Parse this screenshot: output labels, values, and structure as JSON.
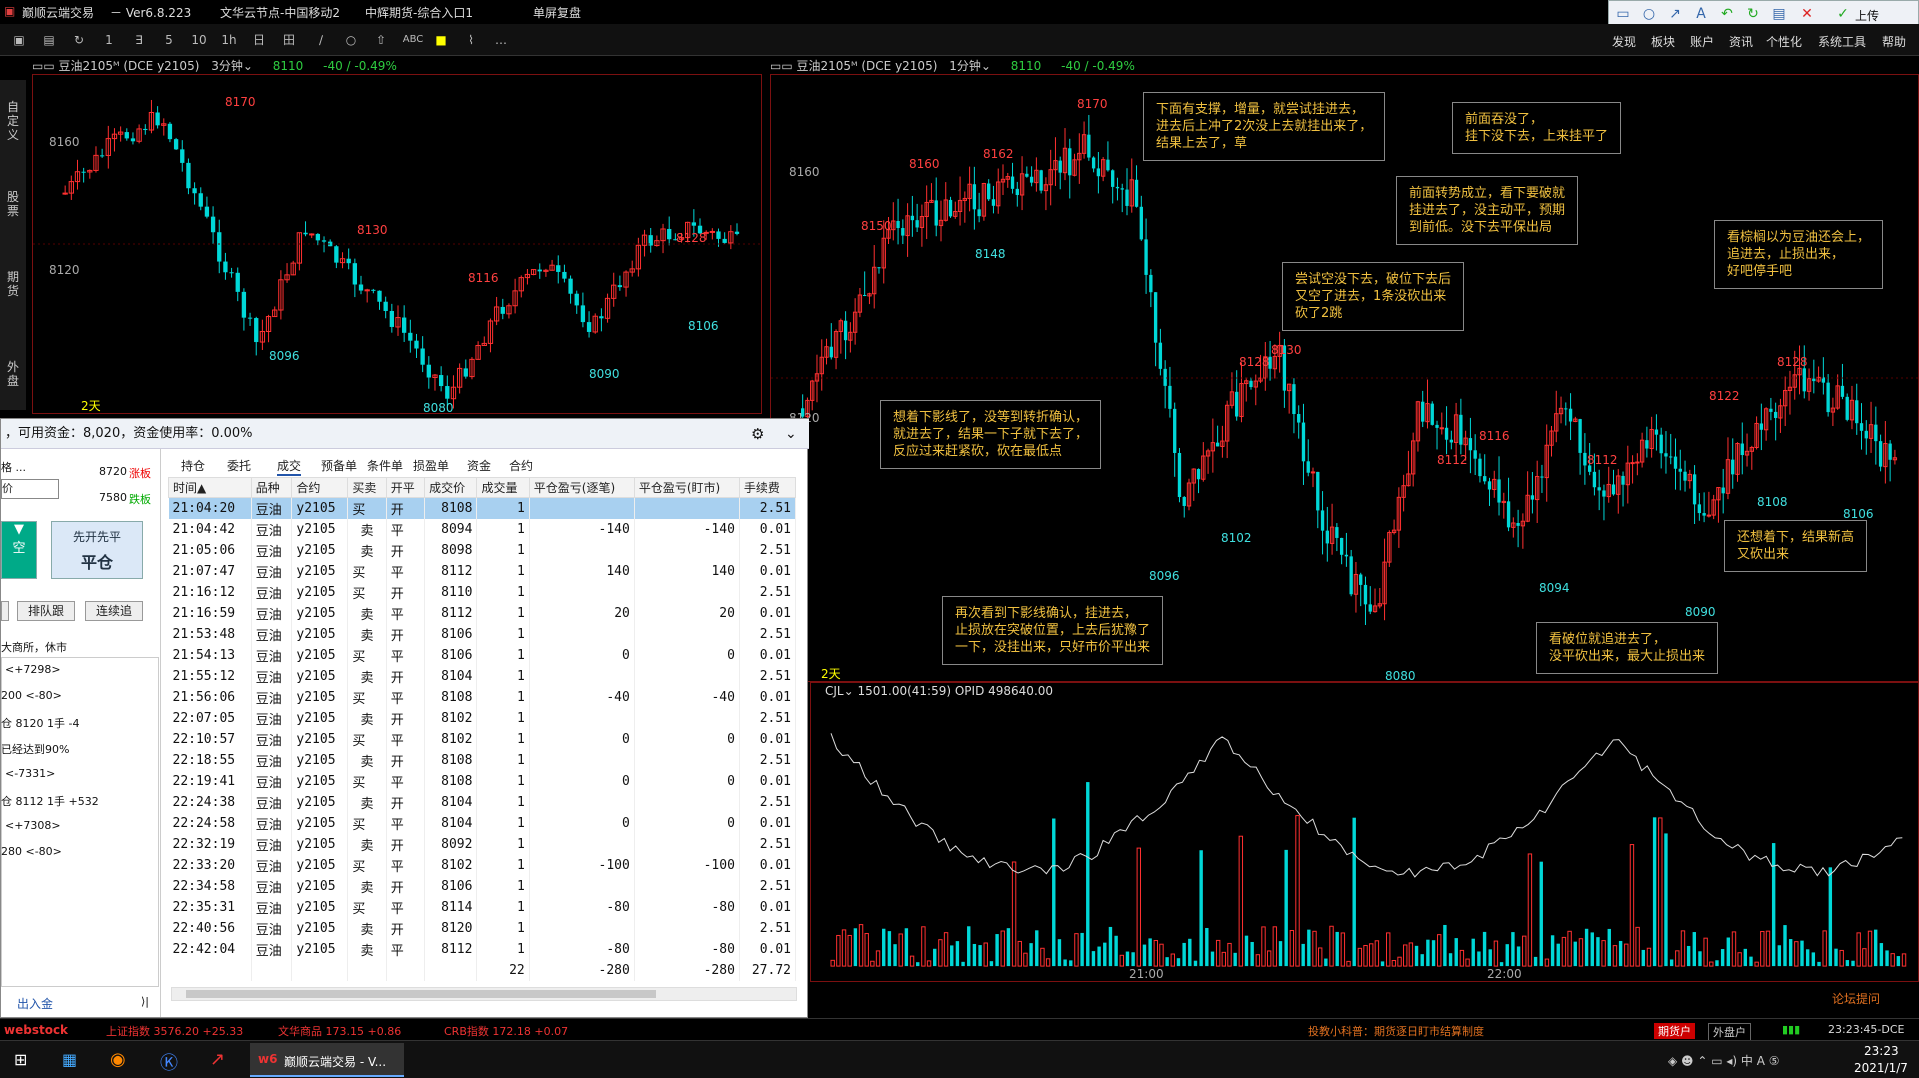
{
  "titlebar": {
    "app": "巅顺云端交易",
    "version": "－ Ver6.8.223",
    "node": "文华云节点-中国移动2",
    "entry": "中辉期货-综合入口1",
    "mode": "单屏复盘"
  },
  "toolbar": {
    "icons": [
      "1",
      "∃",
      "5",
      "10",
      "1h",
      "日",
      "田",
      "∕",
      "○",
      "⇧",
      "ABC",
      "■",
      "⌇",
      "…"
    ]
  },
  "menu": [
    "发现",
    "板块",
    "账户",
    "资讯",
    "个性化",
    "系统工具",
    "帮助"
  ],
  "rtools": {
    "upload": "上传"
  },
  "left_chart": {
    "header": "▭▭ 豆油2105ᴹ (DCE y2105)",
    "period": "3分钟⌄",
    "last": "8110",
    "change": "-40 / -0.49%",
    "ticks": [
      "8160",
      "8120"
    ],
    "labels": [
      "8170",
      "8130",
      "8128",
      "8116",
      "8106",
      "8096",
      "8090",
      "8080"
    ],
    "footer": "2天"
  },
  "right_chart": {
    "header": "▭▭ 豆油2105ᴹ (DCE y2105)",
    "period": "1分钟⌄",
    "last": "8110",
    "change": "-40 / -0.49%",
    "ticks": [
      "8160",
      "8120"
    ],
    "labels": [
      "8170",
      "8162",
      "8160",
      "8150",
      "8148",
      "8130",
      "8128",
      "8128",
      "8122",
      "8116",
      "8112",
      "8112",
      "8108",
      "8106",
      "8102",
      "8096",
      "8094",
      "8090",
      "8080"
    ],
    "footer": "2天"
  },
  "notes": [
    "下面有支撑，增量，就尝试挂进去，\n进去后上冲了2次没上去就挂出来了，\n结果上去了，草",
    "前面吞没了，\n挂下没下去，上来挂平了",
    "前面转势成立，看下要破就\n挂进去了，没主动平，预期\n到前低。没下去平保出局",
    "尝试空没下去，破位下去后\n又空了进去，1条没砍出来\n砍了2跳",
    "看棕榈以为豆油还会上，\n追进去，止损出来，\n好吧停手吧",
    "想着下影线了，没等到转折确认，\n就进去了，结果一下子就下去了，\n反应过来赶紧砍，砍在最低点",
    "还想着下，结果新高\n又砍出来",
    "再次看到下影线确认，挂进去，\n止损放在突破位置，上去后犹豫了\n一下，没挂出来，只好市价平出来",
    "看破位就追进去了，\n没平砍出来，最大止损出来"
  ],
  "volume": {
    "header": "CJL⌄  1501.00(41:59)  OPID 498640.00",
    "times": [
      "21:00",
      "22:00"
    ]
  },
  "sidetabs": [
    "自定义",
    "股票",
    "期货",
    "外盘"
  ],
  "panel": {
    "header": "，可用资金：8,020，资金使用率：0.00%",
    "left": {
      "l1": "格 ...",
      "p1": "8720",
      "t1": "涨板",
      "p2": "7580",
      "t2": "跌板",
      "price": "价",
      "btn1": "先开先平",
      "btn2": "平仓",
      "q1": "排队跟",
      "q2": "连续追",
      "ex": "大商所，休市",
      "lines": [
        "<+7298>",
        "200 <-80>",
        "仓 8120 1手 -4",
        "已经达到90%",
        "<-7331>",
        "仓 8112 1手 +532",
        "<+7308>",
        "280 <-80>"
      ],
      "funds": "出入金"
    },
    "tabs": [
      "持仓",
      "委托",
      "成交",
      "预备单",
      "条件单",
      "损盈单",
      "资金",
      "合约"
    ],
    "columns": [
      "时间▲",
      "品种",
      "合约",
      "买卖",
      "开平",
      "成交价",
      "成交量",
      "平仓盈亏(逐笔)",
      "平仓盈亏(盯市)",
      "手续费"
    ],
    "rows": [
      [
        "21:04:20",
        "豆油",
        "y2105",
        "买",
        "开",
        "8108",
        "1",
        "",
        "",
        "2.51"
      ],
      [
        "21:04:42",
        "豆油",
        "y2105",
        "卖",
        "平",
        "8094",
        "1",
        "-140",
        "-140",
        "0.01"
      ],
      [
        "21:05:06",
        "豆油",
        "y2105",
        "卖",
        "开",
        "8098",
        "1",
        "",
        "",
        "2.51"
      ],
      [
        "21:07:47",
        "豆油",
        "y2105",
        "买",
        "平",
        "8112",
        "1",
        "140",
        "140",
        "0.01"
      ],
      [
        "21:16:12",
        "豆油",
        "y2105",
        "买",
        "开",
        "8110",
        "1",
        "",
        "",
        "2.51"
      ],
      [
        "21:16:59",
        "豆油",
        "y2105",
        "卖",
        "平",
        "8112",
        "1",
        "20",
        "20",
        "0.01"
      ],
      [
        "21:53:48",
        "豆油",
        "y2105",
        "卖",
        "开",
        "8106",
        "1",
        "",
        "",
        "2.51"
      ],
      [
        "21:54:13",
        "豆油",
        "y2105",
        "买",
        "平",
        "8106",
        "1",
        "0",
        "0",
        "0.01"
      ],
      [
        "21:55:12",
        "豆油",
        "y2105",
        "卖",
        "开",
        "8104",
        "1",
        "",
        "",
        "2.51"
      ],
      [
        "21:56:06",
        "豆油",
        "y2105",
        "买",
        "平",
        "8108",
        "1",
        "-40",
        "-40",
        "0.01"
      ],
      [
        "22:07:05",
        "豆油",
        "y2105",
        "卖",
        "开",
        "8102",
        "1",
        "",
        "",
        "2.51"
      ],
      [
        "22:10:57",
        "豆油",
        "y2105",
        "买",
        "平",
        "8102",
        "1",
        "0",
        "0",
        "0.01"
      ],
      [
        "22:18:55",
        "豆油",
        "y2105",
        "卖",
        "开",
        "8108",
        "1",
        "",
        "",
        "2.51"
      ],
      [
        "22:19:41",
        "豆油",
        "y2105",
        "买",
        "平",
        "8108",
        "1",
        "0",
        "0",
        "0.01"
      ],
      [
        "22:24:38",
        "豆油",
        "y2105",
        "卖",
        "开",
        "8104",
        "1",
        "",
        "",
        "2.51"
      ],
      [
        "22:24:58",
        "豆油",
        "y2105",
        "买",
        "平",
        "8104",
        "1",
        "0",
        "0",
        "0.01"
      ],
      [
        "22:32:19",
        "豆油",
        "y2105",
        "卖",
        "开",
        "8092",
        "1",
        "",
        "",
        "2.51"
      ],
      [
        "22:33:20",
        "豆油",
        "y2105",
        "买",
        "平",
        "8102",
        "1",
        "-100",
        "-100",
        "0.01"
      ],
      [
        "22:34:58",
        "豆油",
        "y2105",
        "卖",
        "开",
        "8106",
        "1",
        "",
        "",
        "2.51"
      ],
      [
        "22:35:31",
        "豆油",
        "y2105",
        "买",
        "平",
        "8114",
        "1",
        "-80",
        "-80",
        "0.01"
      ],
      [
        "22:40:56",
        "豆油",
        "y2105",
        "卖",
        "开",
        "8120",
        "1",
        "",
        "",
        "2.51"
      ],
      [
        "22:42:04",
        "豆油",
        "y2105",
        "卖",
        "平",
        "8112",
        "1",
        "-80",
        "-80",
        "0.01"
      ]
    ],
    "total": [
      "",
      "",
      "",
      "",
      "",
      "",
      "22",
      "-280",
      "-280",
      "27.72"
    ]
  },
  "status": {
    "logo": "webstock",
    "idx1": "上证指数 3576.20 +25.33",
    "idx2": "文华商品 173.15 +0.86",
    "idx3": "CRB指数 172.18 +0.07",
    "tip": "投教小科普：期货逐日盯市结算制度",
    "acct1": "期货户",
    "acct2": "外盘户",
    "time": "23:23:45-DCE",
    "forum": "论坛提问"
  },
  "taskbar": {
    "app": "巅顺云端交易 - V...",
    "clock": "23:23",
    "date": "2021/1/7"
  }
}
